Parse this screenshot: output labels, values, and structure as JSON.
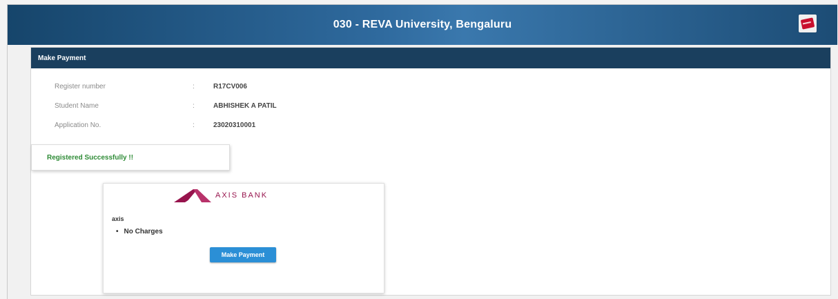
{
  "header": {
    "title": "030 - REVA University, Bengaluru",
    "logout_icon": "card-exit-icon"
  },
  "panel": {
    "title": "Make Payment",
    "fields": [
      {
        "label": "Register number",
        "separator": ":",
        "value": "R17CV006"
      },
      {
        "label": "Student Name",
        "separator": ":",
        "value": "ABHISHEK A PATIL"
      },
      {
        "label": "Application No.",
        "separator": ":",
        "value": "23020310001"
      }
    ],
    "success_message": "Registered Successfully !!",
    "payment_option": {
      "bank_name": "AXIS BANK",
      "bank_code": "axis",
      "features": [
        "No Charges"
      ],
      "button_label": "Make Payment"
    }
  },
  "colors": {
    "header_bg": "#2f6a9e",
    "panel_header_bg": "#1a3f5e",
    "success_text": "#2e8b36",
    "button_bg": "#2b8fd6",
    "bank_brand": "#97144d"
  }
}
